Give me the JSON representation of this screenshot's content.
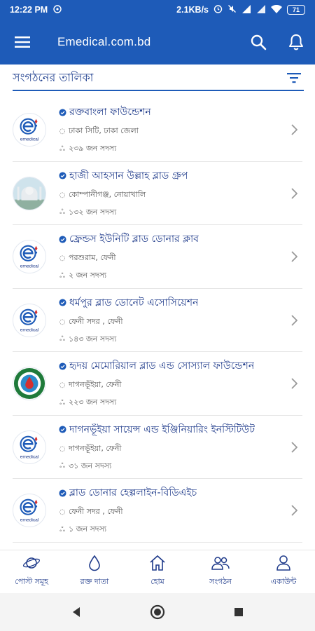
{
  "status_bar": {
    "time": "12:22 PM",
    "net_speed": "2.1KB/s",
    "battery": "71"
  },
  "app_bar": {
    "title": "Emedical.com.bd",
    "menu_icon": "hamburger-menu-icon",
    "search_icon": "search-icon",
    "notification_icon": "bell-icon"
  },
  "section": {
    "title": "সংগঠনের তালিকা",
    "filter_icon": "filter-icon"
  },
  "organizations": [
    {
      "name": "রক্তবাংলা ফাউন্ডেশন",
      "location": "ঢাকা সিটি, ঢাকা জেলা",
      "members": "২৩৯ জন সদস্য",
      "logo": "emedical"
    },
    {
      "name": "হাজী আহসান উল্লাহ ব্লাড গ্রুপ",
      "location": "কোম্পানীগঞ্জ, নোয়াখালি",
      "members": "১৩২ জন সদস্য",
      "logo": "mosque"
    },
    {
      "name": "ফ্রেন্ডস ইউনিটি ব্লাড ডোনার ক্লাব",
      "location": "পরশুরাম, ফেনী",
      "members": "২ জন সদস্য",
      "logo": "emedical"
    },
    {
      "name": "ধর্মপুর ব্লাড ডোনেট এসোসিয়েশন",
      "location": "ফেনী সদর , ফেনী",
      "members": "১৪৩ জন সদস্য",
      "logo": "emedical"
    },
    {
      "name": "হৃদয় মেমোরিয়াল ব্লাড এন্ড সোস্যাল ফাউন্ডেশন",
      "location": "দাগনভূঁইয়া, ফেনী",
      "members": "২২৩ জন সদস্য",
      "logo": "green-seal"
    },
    {
      "name": "দাগনভূঁইয়া সায়েন্স এন্ড ইঞ্জিনিয়ারিং ইনস্টিটিউট",
      "location": "দাগনভূঁইয়া, ফেনী",
      "members": "৩১ জন সদস্য",
      "logo": "emedical"
    },
    {
      "name": "ব্লাড ডোনার হেল্পলাইন-বিডিএইচ",
      "location": "ফেনী সদর , ফেনী",
      "members": "১ জন সদস্য",
      "logo": "emedical"
    }
  ],
  "emedical_logo_text": "emedical",
  "bottom_nav": [
    {
      "label": "পোস্ট সমূহ",
      "icon": "planet-icon"
    },
    {
      "label": "রক্ত দাতা",
      "icon": "drop-icon"
    },
    {
      "label": "হোম",
      "icon": "home-icon"
    },
    {
      "label": "সংগঠন",
      "icon": "group-icon"
    },
    {
      "label": "একাউন্ট",
      "icon": "person-icon"
    }
  ],
  "colors": {
    "primary": "#1e5bb8",
    "text_primary": "#1e3a8a",
    "verified": "#1e5bb8"
  }
}
